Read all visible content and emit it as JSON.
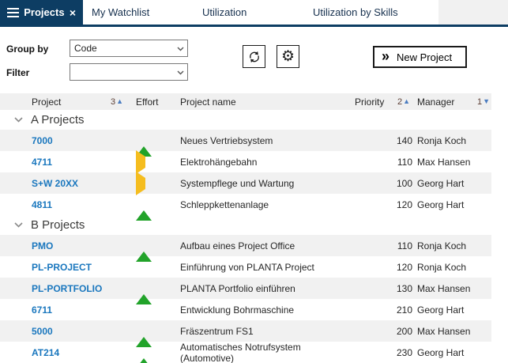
{
  "tabs": {
    "active": {
      "label": "Projects"
    },
    "items": [
      {
        "label": "My Watchlist"
      },
      {
        "label": "Utilization"
      },
      {
        "label": "Utilization by Skills"
      }
    ]
  },
  "icons": {
    "close": "×",
    "gear": "⚙",
    "new_project_chevrons": "»",
    "sort_asc": "▲",
    "sort_desc": "▼"
  },
  "toolbar": {
    "group_by_label": "Group by",
    "group_by_value": "Code",
    "filter_label": "Filter",
    "filter_value": "",
    "new_project_label": "New Project"
  },
  "table": {
    "headers": {
      "project": "Project",
      "project_sort": "3",
      "effort": "Effort",
      "name": "Project name",
      "priority": "Priority",
      "priority_sort": "2",
      "manager": "Manager",
      "manager_sort": "1"
    },
    "groups": [
      {
        "label": "A Projects",
        "rows": [
          {
            "code": "7000",
            "effort": "up",
            "name": "Neues Vertriebsystem",
            "priority": "140",
            "manager": "Ronja Koch"
          },
          {
            "code": "4711",
            "effort": "right",
            "name": "Elektrohängebahn",
            "priority": "110",
            "manager": "Max Hansen"
          },
          {
            "code": "S+W 20XX",
            "effort": "right",
            "name": "Systempflege und Wartung",
            "priority": "100",
            "manager": "Georg Hart"
          },
          {
            "code": "4811",
            "effort": "up",
            "name": "Schleppkettenanlage",
            "priority": "120",
            "manager": "Georg Hart"
          }
        ]
      },
      {
        "label": "B Projects",
        "rows": [
          {
            "code": "PMO",
            "effort": "up",
            "name": "Aufbau eines Project Office",
            "priority": "110",
            "manager": "Ronja Koch"
          },
          {
            "code": "PL-PROJECT",
            "effort": "none",
            "name": "Einführung von PLANTA Project",
            "priority": "120",
            "manager": "Ronja Koch"
          },
          {
            "code": "PL-PORTFOLIO",
            "effort": "up",
            "name": "PLANTA Portfolio einführen",
            "priority": "130",
            "manager": "Max Hansen"
          },
          {
            "code": "6711",
            "effort": "none",
            "name": "Entwicklung Bohrmaschine",
            "priority": "210",
            "manager": "Georg Hart"
          },
          {
            "code": "5000",
            "effort": "up",
            "name": "Fräszentrum FS1",
            "priority": "200",
            "manager": "Max Hansen"
          },
          {
            "code": "AT214",
            "effort": "up",
            "name": "Automatisches Notrufsystem (Automotive)",
            "priority": "230",
            "manager": "Georg Hart"
          }
        ]
      }
    ]
  },
  "colors": {
    "navy": "#0d3d63",
    "link_blue": "#1a77be",
    "effort_green": "#22a32a",
    "effort_amber": "#f5bd1f",
    "row_stripe": "#f1f1f1",
    "header_bg": "#f0f0f0"
  }
}
